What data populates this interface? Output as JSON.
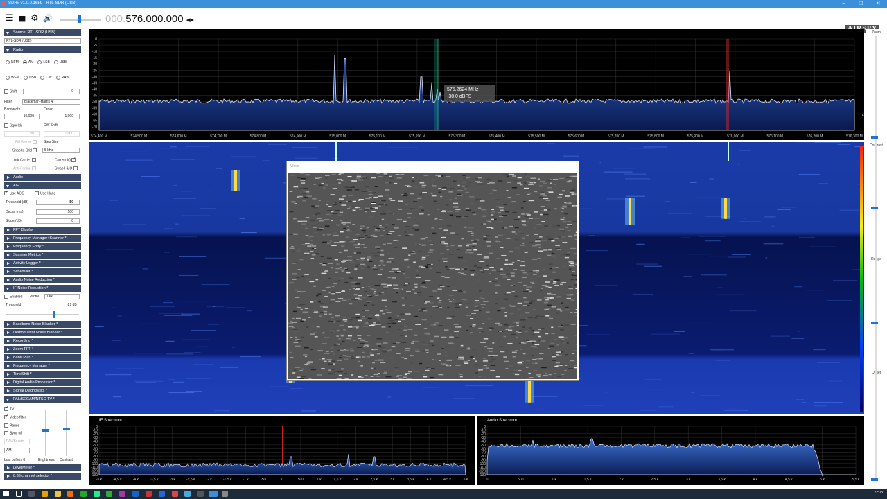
{
  "window": {
    "title": "SDR# v1.0.0.1659 - RTL-SDR (USB)",
    "min": "–",
    "max": "❐",
    "close": "✕"
  },
  "toolbar": {
    "menu_icon": "☰",
    "stop_icon": "■",
    "settings_icon": "⚙",
    "volume_icon": "🔊",
    "freq_dim": "000.",
    "freq": "576.000.000",
    "freq_arrows": "◂▸",
    "logo": "AIRSPY"
  },
  "sidebar": {
    "source_header": "Source: RTL-SDR (USB)",
    "source_value": "RTL-SDR (USB)",
    "radio_header": "Radio",
    "modes_row1": [
      {
        "label": "NFM",
        "on": false
      },
      {
        "label": "AM",
        "on": true
      },
      {
        "label": "LSB",
        "on": false
      },
      {
        "label": "USB",
        "on": false
      }
    ],
    "modes_row2": [
      {
        "label": "WFM",
        "on": false
      },
      {
        "label": "DSB",
        "on": false
      },
      {
        "label": "CW",
        "on": false
      },
      {
        "label": "RAW",
        "on": false
      }
    ],
    "shift_label": "Shift",
    "shift_value": "0",
    "filter_label": "Filter",
    "filter_value": "Blackman-Harris 4",
    "bandwidth_label": "Bandwidth",
    "bandwidth_value": "10,000",
    "order_label": "Order",
    "order_value": "1,000",
    "squelch_label": "Squelch",
    "squelch_value": "50",
    "cwshift_label": "CW Shift",
    "cwshift_value": "1,000",
    "fmstereo_label": "FM Stereo",
    "stepsize_label": "Step Size",
    "snap_label": "Snap to Grid",
    "snap_value": "5 kHz",
    "lockcarrier_label": "Lock Carrier",
    "correctiq_label": "Correct IQ",
    "antifading_label": "Anti-Fading",
    "swapiq_label": "Swap I & Q",
    "audio_header": "Audio",
    "agc_header": "AGC",
    "useagc_label": "Use AGC",
    "usehang_label": "Use Hang",
    "threshold_label": "Threshold (dB)",
    "threshold_value": "-50",
    "decay_label": "Decay (ms)",
    "decay_value": "500",
    "slope_label": "Slope (dB)",
    "slope_value": "0",
    "fft_header": "FFT Display",
    "plugins1": [
      "Frequency Manager+Scanner *",
      "Frequency Entry *",
      "Scanner Metrics *",
      "Activity Logger *",
      "Scheduler *",
      "Audio Noise Reduction *",
      "IF Noise Reduction *"
    ],
    "nr_enabled": "Enabled",
    "nr_profile": "Profile",
    "nr_profile_value": "Talk",
    "nr_threshold": "Threshold",
    "nr_threshold_value": "-21 dB",
    "plugins2": [
      "Baseband Noise Blanker *",
      "Demodulator Noise Blanker *",
      "Recording *",
      "Zoom FFT *",
      "Band Plan *",
      "Frequency Manager *",
      "TimeShift *",
      "Digital Audio Processor *",
      "Signal Diagnostics *",
      "PAL/SECAM/NTSC TV *"
    ],
    "tv_label": "TV",
    "videofilter_label": "Video filter",
    "pause_label": "Pause",
    "syncoff_label": "Sync off",
    "tvstd_value": "PAL/Secam",
    "tvmod_value": "AM",
    "lostbuffers": "Lost buffers 0",
    "brightness": "Brightness",
    "contrast": "Contrast",
    "plugins3": [
      "LevelMeter *",
      "8.33 channel selector *"
    ]
  },
  "spectrum": {
    "y_labels": [
      "0",
      "-5",
      "-10",
      "-15",
      "-20",
      "-25",
      "-30",
      "-35",
      "-40",
      "-45",
      "-50",
      "-55",
      "-60",
      "-65",
      "-70"
    ],
    "x_labels": [
      "574,400 M",
      "574,500 M",
      "574,600 M",
      "574,700 M",
      "574,800 M",
      "574,900 M",
      "575,000 M",
      "575,100 M",
      "575,200 M",
      "575,300 M",
      "575,400 M",
      "575,500 M",
      "575,600 M",
      "575,700 M",
      "575,800 M",
      "575,900 M",
      "576,000 M",
      "576,100 M",
      "576,200 M",
      "576,300 M"
    ],
    "tooltip_freq": "575,2624 MHz",
    "tooltip_level": "-30,0 dBFS",
    "side_value": "16"
  },
  "rightbar": {
    "zoom": "Zoom",
    "contrast": "Contrast",
    "range": "Range",
    "offset": "Offset"
  },
  "video": {
    "title": "Video"
  },
  "if_spectrum": {
    "title": "IF Spectrum",
    "y_labels": [
      "0",
      "-10",
      "-20",
      "-30",
      "-40",
      "-50",
      "-60",
      "-70",
      "-80",
      "-90",
      "-100",
      "-110",
      "-120",
      "-130"
    ],
    "x_labels": [
      "-5 k",
      "-4,5 k",
      "-4 k",
      "-3,5 k",
      "-3 k",
      "-2,5 k",
      "-2 k",
      "-1,5 k",
      "-1 k",
      "-500",
      "0",
      "500",
      "1 k",
      "1,5 k",
      "2 k",
      "2,5 k",
      "3 k",
      "3,5 k",
      "4 k",
      "4,5 k",
      "5 k"
    ]
  },
  "audio_spectrum": {
    "title": "Audio Spectrum",
    "y_labels": [
      "0",
      "-10",
      "-20",
      "-30",
      "-40",
      "-50",
      "-60",
      "-70",
      "-80",
      "-90",
      "-100",
      "-110",
      "-120",
      "-130"
    ],
    "x_labels": [
      "0",
      "500",
      "1 k",
      "1,5 k",
      "2 k",
      "2,5 k",
      "3 k",
      "3,5 k",
      "4 k",
      "4,5 k",
      "5 k",
      "5,5 k"
    ]
  },
  "taskbar": {
    "clock": "22:03"
  }
}
